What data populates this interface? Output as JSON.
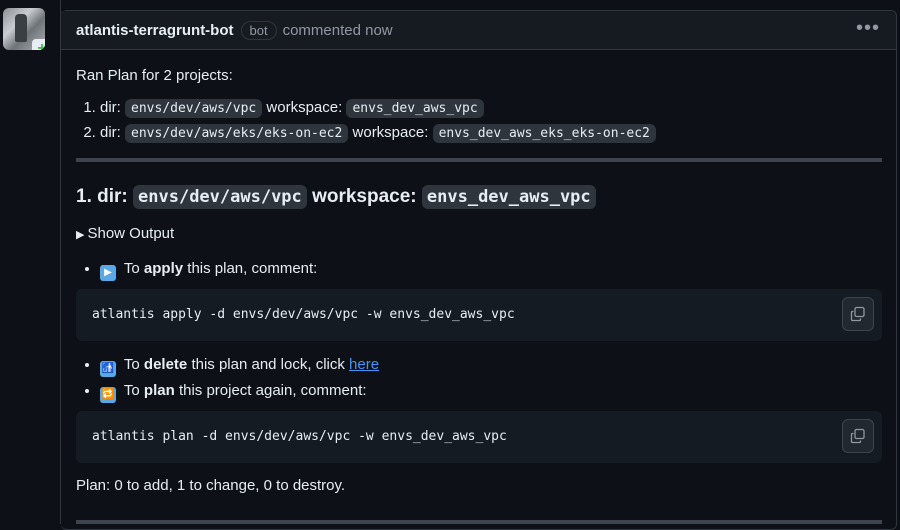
{
  "comment": {
    "author": "atlantis-terragrunt-bot",
    "badge": "bot",
    "timestamp": "commented now",
    "menu_icon": "kebab-horizontal-icon"
  },
  "body": {
    "intro": "Ran Plan for 2 projects:",
    "projects": [
      {
        "num": "1.",
        "dir_label": "dir:",
        "dir": "envs/dev/aws/vpc",
        "ws_label": "workspace:",
        "ws": "envs_dev_aws_vpc"
      },
      {
        "num": "2.",
        "dir_label": "dir:",
        "dir": "envs/dev/aws/eks/eks-on-ec2",
        "ws_label": "workspace:",
        "ws": "envs_dev_aws_eks_eks-on-ec2"
      }
    ],
    "section_title_prefix": "1. dir:",
    "section_dir": "envs/dev/aws/vpc",
    "section_ws_label": "workspace:",
    "section_ws": "envs_dev_aws_vpc",
    "show_output": "Show Output",
    "apply": {
      "pre": "To",
      "bold": "apply",
      "post": "this plan, comment:",
      "icon": "play-button-icon",
      "command": "atlantis apply -d envs/dev/aws/vpc -w envs_dev_aws_vpc"
    },
    "delete": {
      "pre": "To",
      "bold": "delete",
      "post": "this plan and lock, click",
      "link": "here",
      "icon": "put-litter-icon"
    },
    "plan": {
      "pre": "To",
      "bold": "plan",
      "post": "this project again, comment:",
      "icon": "repeat-icon",
      "command": "atlantis plan -d envs/dev/aws/vpc -w envs_dev_aws_vpc"
    },
    "summary": "Plan: 0 to add, 1 to change, 0 to destroy."
  },
  "colors": {
    "background": "#0d1117",
    "text": "#e6edf3",
    "muted": "#9198a1",
    "link": "#4493f8",
    "code_bg": "#2f353d"
  }
}
